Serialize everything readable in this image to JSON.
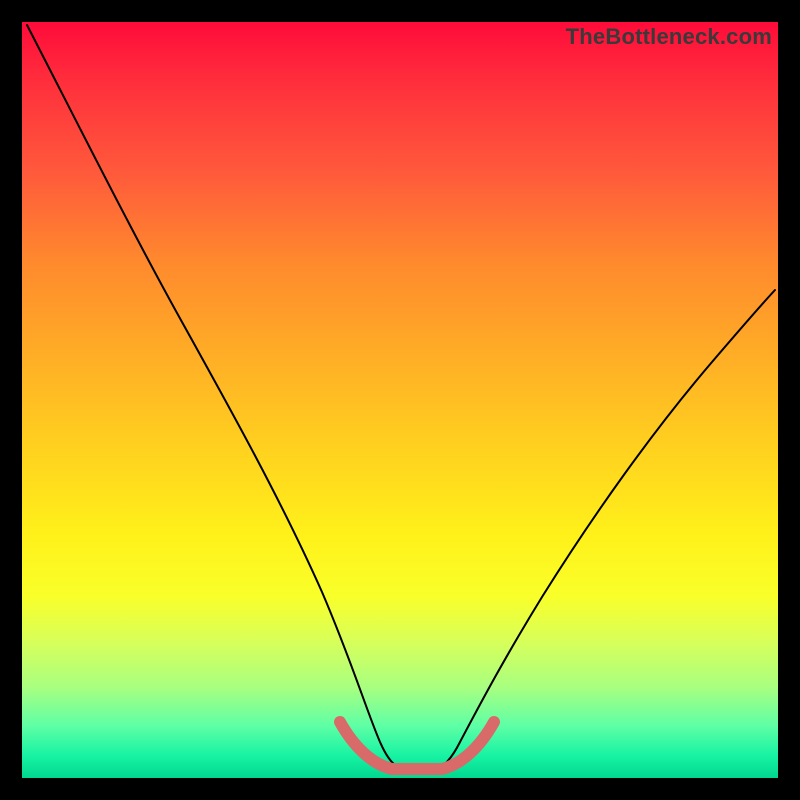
{
  "watermark": "TheBottleneck.com",
  "colors": {
    "frame": "#000000",
    "curve": "#000000",
    "tolerance_band": "#d86a6a",
    "gradient_top": "#ff0b3a",
    "gradient_bottom": "#00d890"
  },
  "chart_data": {
    "type": "line",
    "title": "",
    "xlabel": "",
    "ylabel": "",
    "xlim": [
      0,
      100
    ],
    "ylim": [
      0,
      100
    ],
    "grid": false,
    "legend": false,
    "series": [
      {
        "name": "bottleneck-curve",
        "x": [
          0,
          5,
          10,
          15,
          20,
          25,
          30,
          35,
          40,
          43,
          46,
          50,
          54,
          57,
          60,
          65,
          70,
          75,
          80,
          85,
          90,
          95,
          100
        ],
        "y": [
          100,
          88,
          77,
          67,
          57,
          47,
          38,
          29,
          20,
          13,
          7,
          3,
          3,
          7,
          13,
          21,
          29,
          36,
          43,
          49,
          55,
          60,
          65
        ]
      },
      {
        "name": "tolerance-band",
        "x": [
          40,
          43,
          46,
          50,
          54,
          57,
          60
        ],
        "y": [
          8,
          5,
          3,
          3,
          3,
          5,
          8
        ]
      }
    ],
    "annotations": []
  }
}
